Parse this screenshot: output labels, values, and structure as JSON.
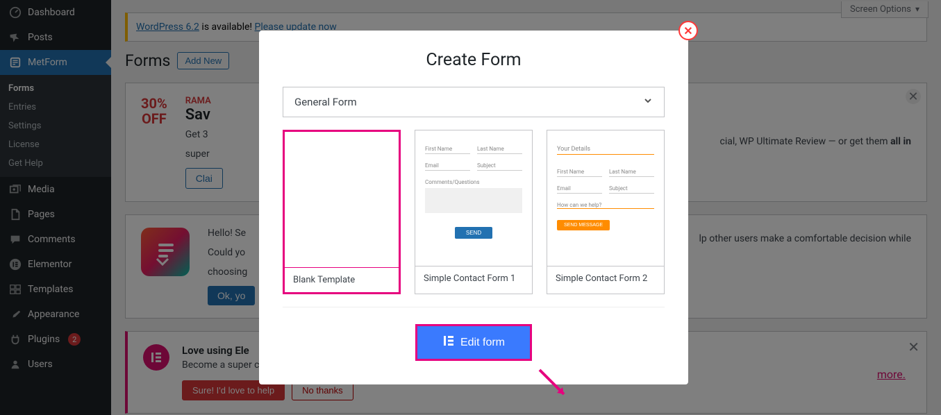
{
  "screen_options": "Screen Options",
  "update_notice": {
    "link": "WordPress 6.2",
    "text": " is available! ",
    "update_link": "Please update now"
  },
  "page_title": "Forms",
  "add_new": "Add New",
  "sidebar": {
    "items": [
      {
        "label": "Dashboard"
      },
      {
        "label": "Posts"
      },
      {
        "label": "MetForm"
      },
      {
        "label": "Media"
      },
      {
        "label": "Pages"
      },
      {
        "label": "Comments"
      },
      {
        "label": "Elementor"
      },
      {
        "label": "Templates"
      },
      {
        "label": "Appearance"
      },
      {
        "label": "Plugins",
        "badge": "2"
      },
      {
        "label": "Users"
      }
    ],
    "sub": [
      {
        "label": "Forms"
      },
      {
        "label": "Entries"
      },
      {
        "label": "Settings"
      },
      {
        "label": "License"
      },
      {
        "label": "Get Help"
      }
    ]
  },
  "promo": {
    "label": "RAMA",
    "badge_1": "30%",
    "badge_2": "OFF",
    "title": "Sav",
    "text1": "Get 3",
    "text2": "WP Ultimate Review — or get them ",
    "text_bold": "all in",
    "text3": "super",
    "claim": "Clai"
  },
  "review": {
    "line1": "Hello! Se",
    "line2": "Could yo",
    "line3": "choosing",
    "tail": "lp other users make a comfortable decision while",
    "ok": "Ok, yo"
  },
  "elementor_notice": {
    "title": "Love using Ele",
    "sub": "Become a super con",
    "more": "more.",
    "sure": "Sure! I'd love to help",
    "no": "No thanks"
  },
  "modal": {
    "title": "Create Form",
    "select": "General Form",
    "templates": [
      {
        "label": "Blank Template"
      },
      {
        "label": "Simple Contact Form 1"
      },
      {
        "label": "Simple Contact Form 2"
      }
    ],
    "edit_btn": "Edit form",
    "tpl1": {
      "first_name": "First Name",
      "last_name": "Last Name",
      "email": "Email",
      "subject": "Subject",
      "comments": "Comments/Questions",
      "send": "SEND"
    },
    "tpl2": {
      "your_details": "Your Details",
      "first_name": "First Name",
      "last_name": "Last Name",
      "email": "Email",
      "subject": "Subject",
      "help": "How can we help?",
      "send": "SEND MESSAGE"
    }
  }
}
